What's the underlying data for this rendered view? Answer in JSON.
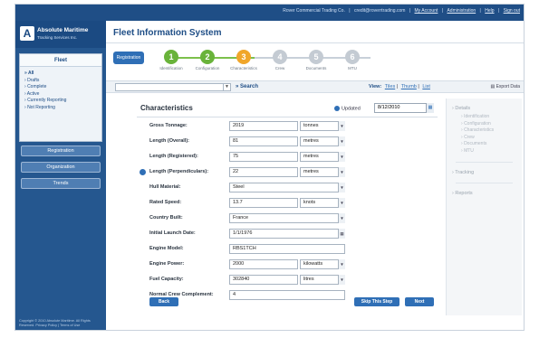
{
  "topbar": {
    "company": "Rover Commercial Trading Co.",
    "email": "credit@roverrtrading.com",
    "links": [
      "My Account",
      "Administration",
      "Help",
      "Sign out"
    ]
  },
  "logo": {
    "title": "Absolute Maritime",
    "subtitle": "Tracking Services Inc."
  },
  "sidebar": {
    "filter_title": "Fleet",
    "filters": [
      "All",
      "Drafts",
      "Complete",
      "Active",
      "Currently Reporting",
      "Not Reporting"
    ],
    "buttons": [
      "Registration",
      "Organization",
      "Trends"
    ],
    "copyright": "Copyright © 2010 Absolute Maritime. All Rights Reserved. Privacy Policy | Terms of Use"
  },
  "page": {
    "title": "Fleet Information System"
  },
  "stepper": {
    "registration_label": "Registration",
    "steps": [
      {
        "num": "1",
        "label": "Identification",
        "state": "done"
      },
      {
        "num": "2",
        "label": "Configuration",
        "state": "done"
      },
      {
        "num": "3",
        "label": "Characteristics",
        "state": "current"
      },
      {
        "num": "4",
        "label": "Crew",
        "state": "todo"
      },
      {
        "num": "5",
        "label": "Documents",
        "state": "todo"
      },
      {
        "num": "6",
        "label": "MTU",
        "state": "todo"
      }
    ]
  },
  "searchbar": {
    "search_label": "Search",
    "view_label": "View:",
    "view_options": [
      "Tiles",
      "Thumb",
      "List"
    ],
    "export_label": "Export Data"
  },
  "form": {
    "title": "Characteristics",
    "updated_label": "Updated",
    "updated_date": "8/12/2010",
    "rows": [
      {
        "label": "Gross Tonnage:",
        "value": "2019",
        "unit": "tonnes",
        "info": false
      },
      {
        "label": "Length (Overall):",
        "value": "81",
        "unit": "metres",
        "info": false
      },
      {
        "label": "Length (Registered):",
        "value": "75",
        "unit": "metres",
        "info": false
      },
      {
        "label": "Length (Perpendiculars):",
        "value": "22",
        "unit": "metres",
        "info": true
      },
      {
        "label": "Hull Material:",
        "value": "Steel",
        "unit": "",
        "info": false
      },
      {
        "label": "Rated Speed:",
        "value": "13.7",
        "unit": "knots",
        "info": false
      },
      {
        "label": "Country Built:",
        "value": "France",
        "unit": "",
        "info": false
      },
      {
        "label": "Initial Launch Date:",
        "value": "1/1/1976",
        "unit": "",
        "info": false
      },
      {
        "label": "Engine Model:",
        "value": "RBS1TCH",
        "unit": "",
        "info": false
      },
      {
        "label": "Engine Power:",
        "value": "2000",
        "unit": "kilowatts",
        "info": false
      },
      {
        "label": "Fuel Capacity:",
        "value": "302840",
        "unit": "litres",
        "info": false
      },
      {
        "label": "Normal Crew Complement:",
        "value": "4",
        "unit": "",
        "info": false
      }
    ],
    "back_label": "Back",
    "skip_label": "Skip This Step",
    "next_label": "Next"
  },
  "right_panel": {
    "details_label": "Details",
    "details_items": [
      "Identification",
      "Configuration",
      "Characteristics",
      "Crew",
      "Documents",
      "MTU"
    ],
    "tracking_label": "Tracking",
    "reports_label": "Reports"
  }
}
